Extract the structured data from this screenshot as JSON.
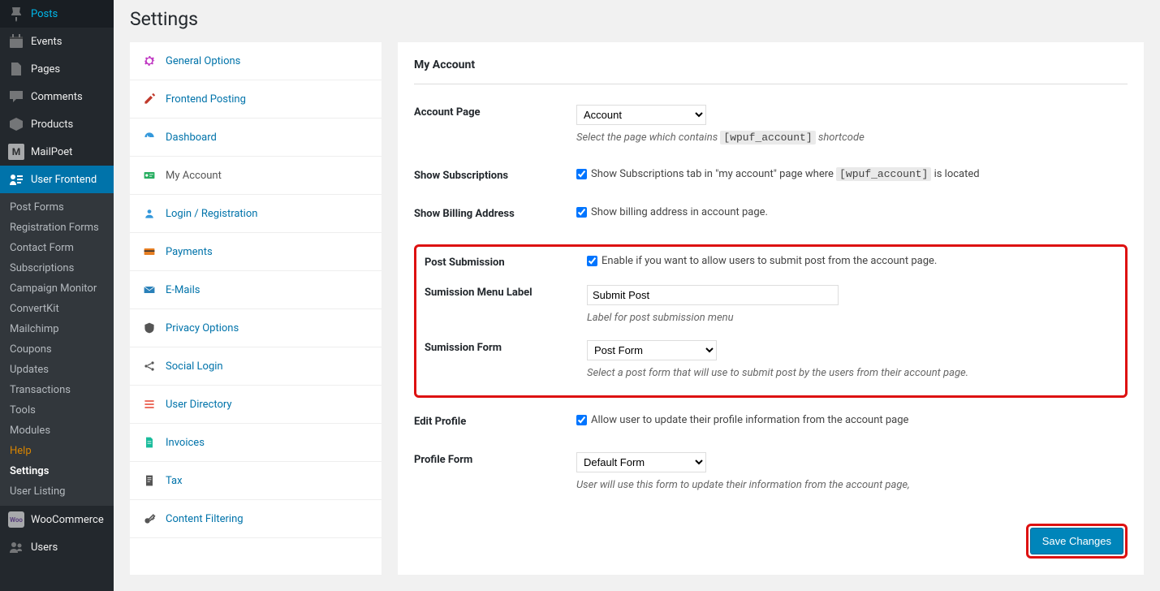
{
  "pageTitle": "Settings",
  "leftSidebar": {
    "mainItems": [
      {
        "icon": "pin",
        "label": "Posts"
      },
      {
        "icon": "calendar",
        "label": "Events"
      },
      {
        "icon": "page",
        "label": "Pages"
      },
      {
        "icon": "comment",
        "label": "Comments"
      },
      {
        "icon": "box",
        "label": "Products"
      },
      {
        "icon": "m",
        "label": "MailPoet"
      },
      {
        "icon": "uf",
        "label": "User Frontend",
        "active": true
      }
    ],
    "subItems": [
      {
        "label": "Post Forms"
      },
      {
        "label": "Registration Forms"
      },
      {
        "label": "Contact Form"
      },
      {
        "label": "Subscriptions"
      },
      {
        "label": "Campaign Monitor"
      },
      {
        "label": "ConvertKit"
      },
      {
        "label": "Mailchimp"
      },
      {
        "label": "Coupons"
      },
      {
        "label": "Updates"
      },
      {
        "label": "Transactions"
      },
      {
        "label": "Tools"
      },
      {
        "label": "Modules"
      },
      {
        "label": "Help",
        "help": true
      },
      {
        "label": "Settings",
        "active": true
      },
      {
        "label": "User Listing"
      }
    ],
    "bottomItems": [
      {
        "icon": "woo",
        "label": "WooCommerce"
      },
      {
        "icon": "users",
        "label": "Users"
      }
    ]
  },
  "settingsTabs": [
    {
      "icon": "gear",
      "label": "General Options",
      "color": "#c039c3"
    },
    {
      "icon": "edit",
      "label": "Frontend Posting",
      "color": "#c0392b"
    },
    {
      "icon": "dashboard",
      "label": "Dashboard",
      "color": "#3498db"
    },
    {
      "icon": "card",
      "label": "My Account",
      "color": "#27ae60",
      "active": true
    },
    {
      "icon": "user",
      "label": "Login / Registration",
      "color": "#3498db"
    },
    {
      "icon": "credit",
      "label": "Payments",
      "color": "#e67e22"
    },
    {
      "icon": "mail",
      "label": "E-Mails",
      "color": "#2980b9"
    },
    {
      "icon": "shield",
      "label": "Privacy Options",
      "color": "#555"
    },
    {
      "icon": "share",
      "label": "Social Login",
      "color": "#555"
    },
    {
      "icon": "list",
      "label": "User Directory",
      "color": "#e74c3c"
    },
    {
      "icon": "doc",
      "label": "Invoices",
      "color": "#1abc9c"
    },
    {
      "icon": "tax",
      "label": "Tax",
      "color": "#555"
    },
    {
      "icon": "key",
      "label": "Content Filtering",
      "color": "#555"
    }
  ],
  "panel": {
    "title": "My Account",
    "accountPage": {
      "label": "Account Page",
      "value": "Account",
      "descPrefix": "Select the page which contains ",
      "shortcode": "[wpuf_account]",
      "descSuffix": " shortcode"
    },
    "showSubscriptions": {
      "label": "Show Subscriptions",
      "checkPrefix": "Show Subscriptions tab in \"my account\" page where ",
      "shortcode": "[wpuf_account]",
      "checkSuffix": " is located",
      "checked": true
    },
    "showBilling": {
      "label": "Show Billing Address",
      "check": "Show billing address in account page.",
      "checked": true
    },
    "postSubmission": {
      "label": "Post Submission",
      "check": "Enable if you want to allow users to submit post from the account page.",
      "checked": true
    },
    "submissionMenuLabel": {
      "label": "Sumission Menu Label",
      "value": "Submit Post",
      "desc": "Label for post submission menu"
    },
    "submissionForm": {
      "label": "Sumission Form",
      "value": "Post Form",
      "desc": "Select a post form that will use to submit post by the users from their account page."
    },
    "editProfile": {
      "label": "Edit Profile",
      "check": "Allow user to update their profile information from the account page",
      "checked": true
    },
    "profileForm": {
      "label": "Profile Form",
      "value": "Default Form",
      "desc": "User will use this form to update their information from the account page,"
    },
    "saveButton": "Save Changes"
  }
}
